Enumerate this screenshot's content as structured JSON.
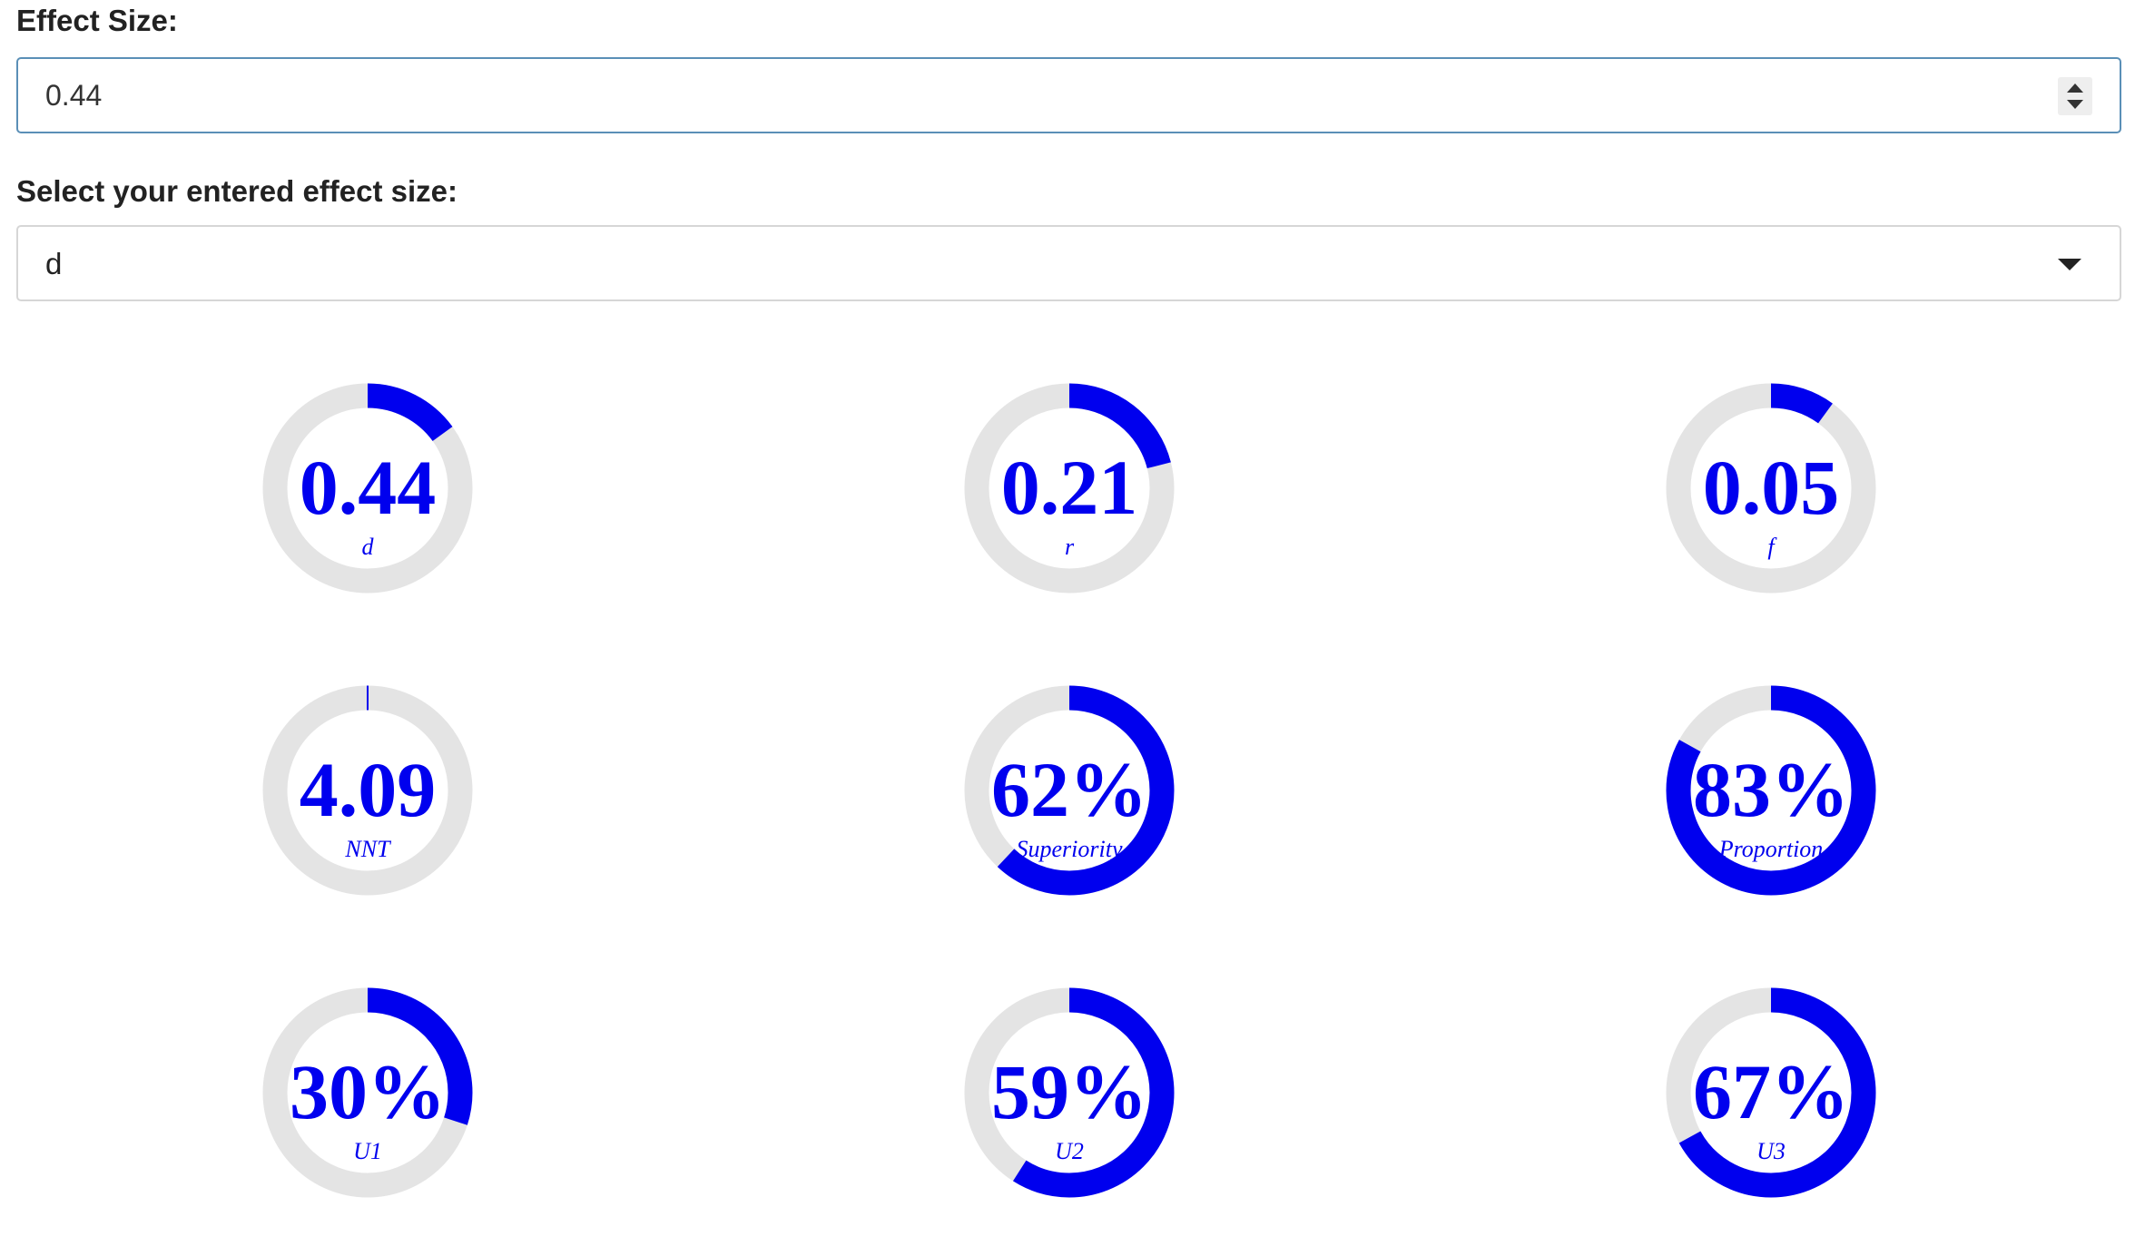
{
  "effect_size": {
    "label": "Effect Size:",
    "value": "0.44"
  },
  "effect_type": {
    "label": "Select your entered effect size:",
    "selected": "d"
  },
  "colors": {
    "accent": "#0000ee",
    "track": "#e4e4e4"
  },
  "gauges": [
    {
      "value_text": "0.44",
      "label": "d",
      "fill": 0.15
    },
    {
      "value_text": "0.21",
      "label": "r",
      "fill": 0.21
    },
    {
      "value_text": "0.05",
      "label": "f",
      "fill": 0.1
    },
    {
      "value_text": "4.09",
      "label": "NNT",
      "fill": 0.0
    },
    {
      "value_text": "62%",
      "label": "Superiority",
      "fill": 0.62
    },
    {
      "value_text": "83%",
      "label": "Proportion",
      "fill": 0.83
    },
    {
      "value_text": "30%",
      "label": "U1",
      "fill": 0.3
    },
    {
      "value_text": "59%",
      "label": "U2",
      "fill": 0.59
    },
    {
      "value_text": "67%",
      "label": "U3",
      "fill": 0.67
    }
  ]
}
